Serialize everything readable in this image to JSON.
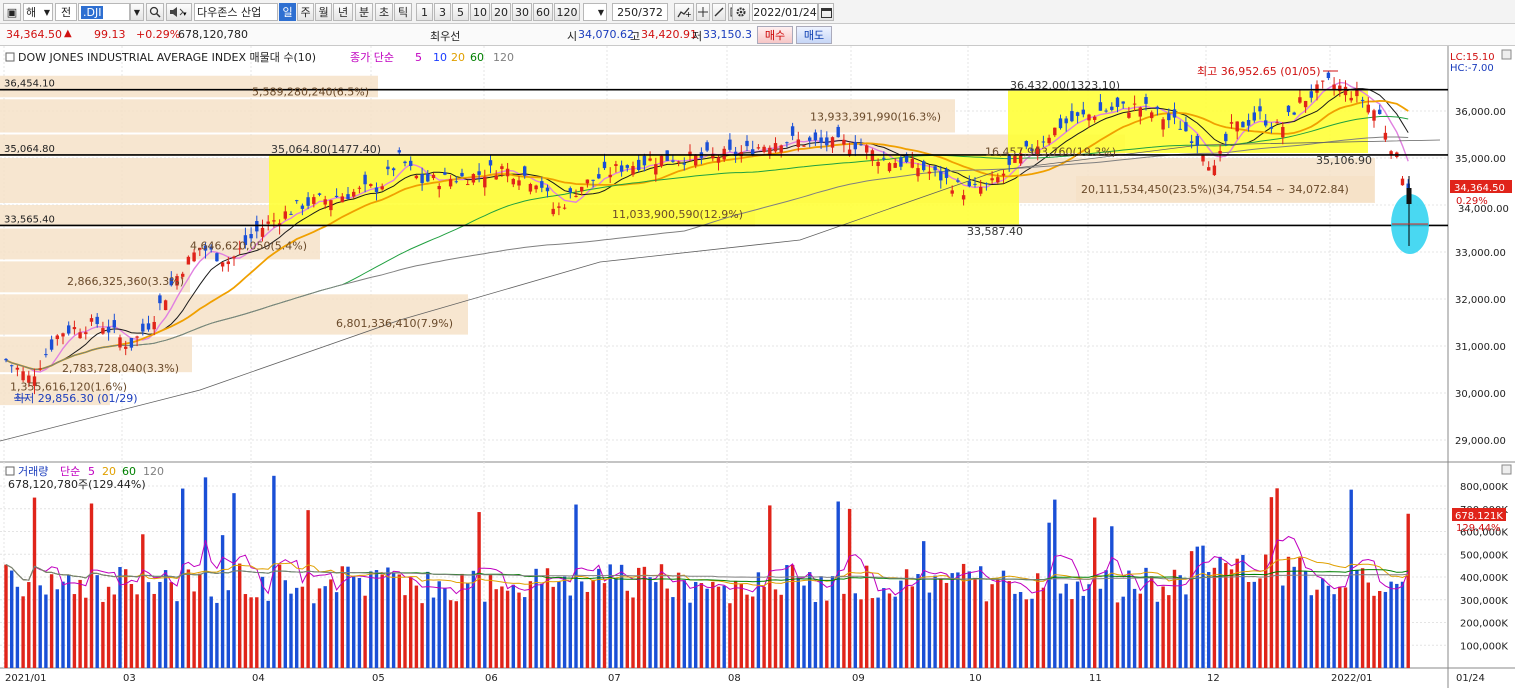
{
  "toolbar": {
    "market_select": "해",
    "prev_label": "전",
    "symbol_input": ".DJI",
    "instrument_name": "다우존스 산업",
    "periods": [
      "일",
      "주",
      "월",
      "년",
      "분",
      "초",
      "틱"
    ],
    "active_period": "일",
    "intervals": [
      "1",
      "3",
      "5",
      "10",
      "20",
      "30",
      "60",
      "120"
    ],
    "count_display": "250/372",
    "date_display": "2022/01/24"
  },
  "quote": {
    "price": "34,364.50",
    "change_arrow": "▲",
    "change": "99.13",
    "change_pct": "+0.29%",
    "volume": "678,120,780",
    "best_bid_label": "최우선",
    "open_label": "시",
    "open": "34,070.62",
    "high_label": "고",
    "high": "34,420.91",
    "low_label": "저",
    "low": "33,150.3",
    "buy_button": "매수",
    "sell_button": "매도"
  },
  "price_panel": {
    "title": "DOW JONES INDUSTRIAL AVERAGE INDEX 매물대 수(10)",
    "ma_label": "종가 단순",
    "ma_periods": [
      "5",
      "10",
      "20",
      "60",
      "120"
    ],
    "ma_colors": [
      "#c000c0",
      "#1a3cff",
      "#e0a000",
      "#008000",
      "#808080"
    ],
    "lc_label": "LC:15.10",
    "hc_label": "HC:-7.00",
    "current_price_tag": "34,364.50",
    "current_pct_tag": "0.29%",
    "partial_axis_label": "34,000.00",
    "y_axis": [
      "36,000.00",
      "35,000.00",
      "34,000.00",
      "33,000.00",
      "32,000.00",
      "31,000.00",
      "30,000.00",
      "29,000.00"
    ],
    "horizontal_levels": [
      "36,454.10",
      "35,064.80",
      "33,565.40"
    ],
    "annotations": {
      "high": "최고 36,952.65 (01/05)",
      "low": "최저 29,856.30 (01/29)",
      "peak_label": "36,432.00(1323.10)",
      "range_label": "35,064.80(1477.40)",
      "level_33587": "33,587.40",
      "level_35106": "35,106.90",
      "current_range_volume": "20,111,534,450(23.5%)(34,754.54 ~ 34,072.84)"
    },
    "volume_profile": [
      "5,589,280,240(6.5%)",
      "13,933,391,990(16.3%)",
      "16,457,903,760(19.3%)",
      "11,033,900,590(12.9%)",
      "4,646,620,050(5.4%)",
      "2,866,325,360(3.3%)",
      "6,801,336,410(7.9%)",
      "2,783,728,040(3.3%)",
      "1,355,616,120(1.6%)"
    ]
  },
  "volume_panel": {
    "title": "거래량",
    "ma_label": "단순",
    "ma_periods": [
      "5",
      "20",
      "60",
      "120"
    ],
    "ma_colors": [
      "#c000c0",
      "#e0a000",
      "#008000",
      "#808080"
    ],
    "current_volume": "678,120,780주(129.44%)",
    "current_tag": "678.121K",
    "current_pct_tag": "129.44%",
    "y_axis": [
      "800,000K",
      "700,000K",
      "600,000K",
      "500,000K",
      "400,000K",
      "300,000K",
      "200,000K",
      "100,000K"
    ]
  },
  "x_axis": [
    "2021/01",
    "03",
    "04",
    "05",
    "06",
    "07",
    "08",
    "09",
    "10",
    "11",
    "12",
    "2022/01"
  ],
  "x_axis_end": "01/24"
}
